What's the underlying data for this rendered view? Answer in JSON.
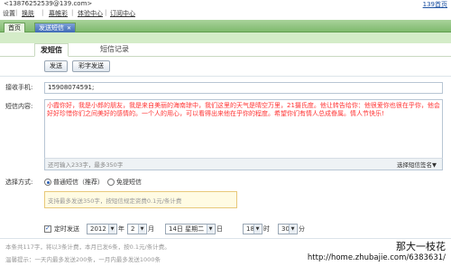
{
  "topbar": {
    "email": "<13876252539@139.com>",
    "right_link": "139首页"
  },
  "menu": {
    "items": [
      "设置",
      "换肤",
      "幕帷彩",
      "体验中心",
      "订阅中心"
    ]
  },
  "window_tabs": [
    {
      "label": "首页"
    },
    {
      "label": "发送短信"
    }
  ],
  "sub_tabs": {
    "active": "发短信",
    "inactive": "短信记录"
  },
  "actions": {
    "send": "发送",
    "mms": "彩字发送"
  },
  "receiver": {
    "label": "接收手机:",
    "value": "15908074591;"
  },
  "content": {
    "label": "短信内容:",
    "text": "小霞你好，我是小郎的朋友，我是来自美丽的海南琼中，我们这里的天气是晴空万里，21摄氏度。他让转告给你：他很爱你也很在乎你，他会好好珍惜你们之间美好的感情的。一个人的用心，可以看得出来他在乎你的程度。希望你们有情人总成眷属。情人节快乐!",
    "remaining": "还可输入233字，最多350字",
    "signature": "选择短信签名▼"
  },
  "send_method": {
    "label": "选择方式:",
    "option1": "普通短信（推荐）",
    "option2": "免提短信",
    "tip": "支持最多发送350字，按短信规定资费0.1元/条计费"
  },
  "schedule": {
    "checkbox_label": "定时发送",
    "year": "2012",
    "year_unit": "年",
    "month": "2",
    "month_unit": "月",
    "day": "14日 星期二",
    "day_unit": "日",
    "hour": "18",
    "hour_unit": "时",
    "minute": "30",
    "minute_unit": "分"
  },
  "notes": {
    "line1": "本条共117字，将以3条计费，本月已发6条，按0.1元/条计费。",
    "line2": "温馨提示：一天内最多发送200条，一月内最多发送1000条"
  },
  "watermark": {
    "line1": "那大一枝花",
    "line2": "http://home.zhubajie.com/6383631/"
  }
}
